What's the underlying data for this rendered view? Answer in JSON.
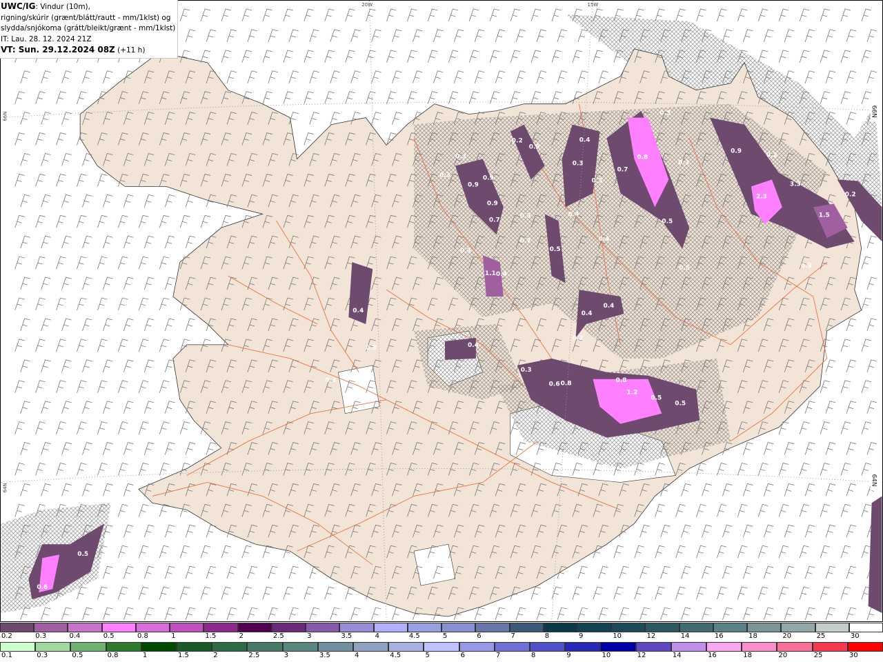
{
  "header": {
    "model": "UWC/IG",
    "line1": ": Vindur (10m),",
    "line2": "rigning/skúrir (grænt/blátt/rautt - mm/1klst) og",
    "line3": "slydda/snjókoma (grátt/bleikt/grænt - mm/1klst)",
    "issue_time": "IT: Lau. 28. 12. 2024 21Z",
    "valid_time": "VT: Sun. 29.12.2024 08Z",
    "lead": "(+11 h)"
  },
  "grid_labels": {
    "lon1": "20W",
    "lon2": "15W",
    "lat1": "66N",
    "lat2": "64N",
    "lat1r": "66N",
    "lat2r": "64N"
  },
  "colors": {
    "sea": "#ffffff",
    "land": "#f2e4d6",
    "roads": "#f07040",
    "snow_light": "#6e4a6e",
    "snow_mid": "#a05fa0",
    "snow_heavy": "#ff80ff"
  },
  "precip_labels": [
    "0.3",
    "0.4",
    "0.9",
    "0.2",
    "0.9",
    "0.2",
    "0.3",
    "0.3",
    "0.7",
    "0.8",
    "0.3",
    "0.3",
    "0.9",
    "0.9",
    "0.3",
    "3.3",
    "2.3",
    "0.2",
    "0.9",
    "0.4",
    "0.3",
    "0.7",
    "1.5",
    "0.5",
    "0.7",
    "0.4",
    "0.3",
    "0.5",
    "0.3",
    "0.5",
    "1.1",
    "0.4",
    "0.4",
    "0.4",
    "0.4",
    "0.2",
    "0.4",
    "0.3",
    "0.3",
    "0.3",
    "0.6",
    "0.8",
    "0.8",
    "1.2",
    "0.5",
    "0.5",
    "0.5",
    "0.6"
  ],
  "legend_snow": {
    "labels": [
      "0.2",
      "0.3",
      "0.4",
      "0.5",
      "0.8",
      "1",
      "1.5",
      "2",
      "2.5",
      "3",
      "3.5",
      "4",
      "4.5",
      "5",
      "6",
      "7",
      "8",
      "9",
      "10",
      "12",
      "14",
      "16",
      "18",
      "20",
      "25",
      "30"
    ],
    "colors": [
      "#6e4a6e",
      "#a05fa0",
      "#c872c8",
      "#ff80ff",
      "#d86cd8",
      "#c050c0",
      "#8c2a8c",
      "#500050",
      "#6a2a7a",
      "#8a5aaa",
      "#9a8ad8",
      "#b0b0ff",
      "#98a0e0",
      "#8890d0",
      "#6878a8",
      "#3a5a78",
      "#0a3a48",
      "#104450",
      "#1c4a58",
      "#2c5860",
      "#406a70",
      "#5a8088",
      "#7a9498",
      "#90a8a8",
      "#c4ccce",
      "#ffffff"
    ]
  },
  "legend_rain": {
    "labels": [
      "0.1",
      "0.3",
      "0.5",
      "0.8",
      "1",
      "1.5",
      "2",
      "2.5",
      "3",
      "3.5",
      "4",
      "4.5",
      "5",
      "6",
      "7",
      "8",
      "9",
      "10",
      "12",
      "14",
      "16",
      "18",
      "20",
      "25",
      "30"
    ],
    "colors": [
      "#ccffcc",
      "#a0d8a0",
      "#70b070",
      "#2e7a2e",
      "#004a00",
      "#1a5a2a",
      "#2e6a44",
      "#487a68",
      "#5a8880",
      "#7090a0",
      "#90a0c0",
      "#a8b0e0",
      "#c0c0ff",
      "#9898e8",
      "#7070d8",
      "#5050c8",
      "#2828b8",
      "#0000a8",
      "#6048c0",
      "#c090e8",
      "#f8a8f0",
      "#f890c8",
      "#f87098",
      "#f83850",
      "#ff0000"
    ]
  }
}
